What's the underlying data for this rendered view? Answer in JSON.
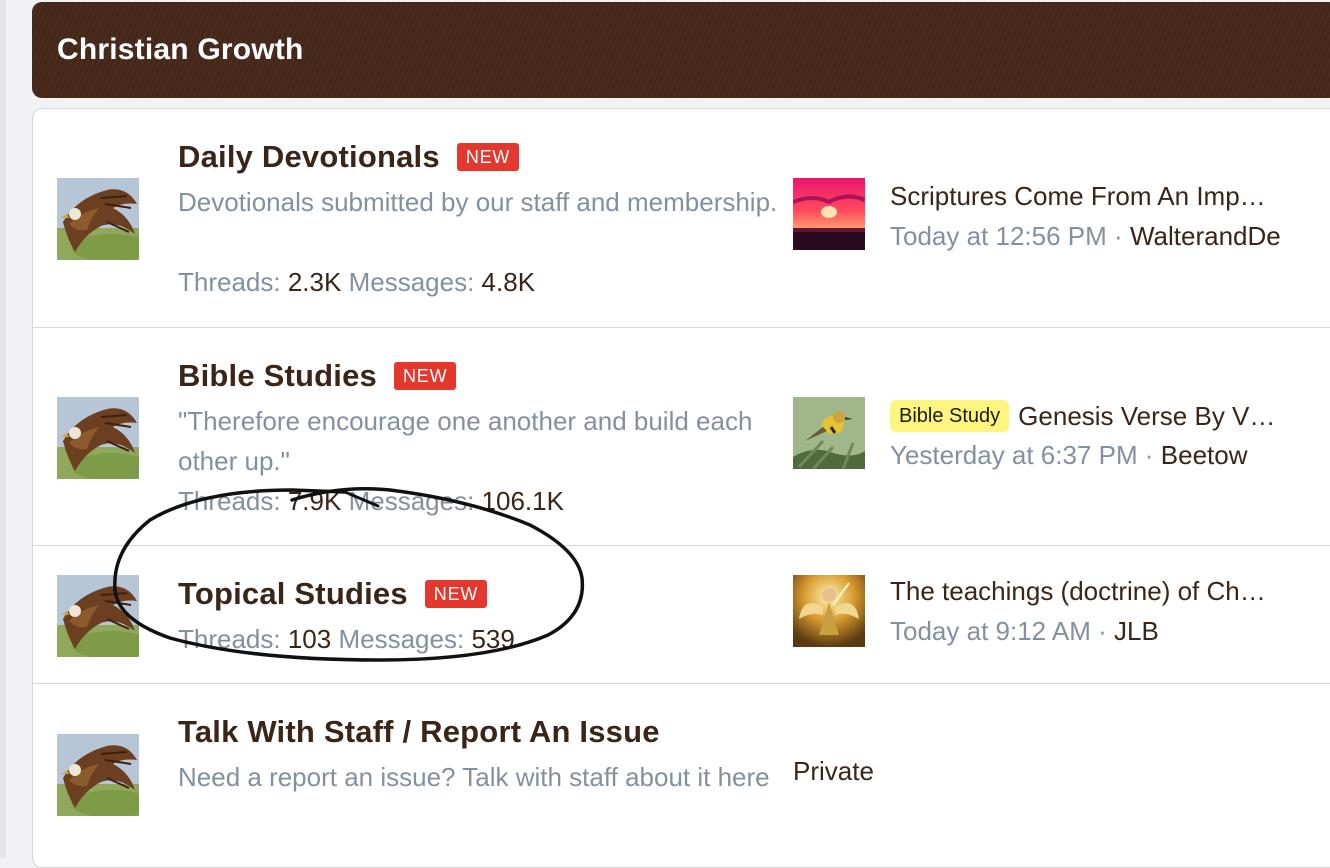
{
  "category": {
    "title": "Christian Growth",
    "color": "#46281a"
  },
  "nodes": [
    {
      "title": "Daily Devotionals",
      "badge": "NEW",
      "description": "Devotionals submitted by our staff and membership.",
      "threads_label": "Threads:",
      "threads": "2.3K",
      "messages_label": "Messages:",
      "messages": "4.8K",
      "icon": "eagle-icon",
      "last_post": {
        "thumb": "sunset-avatar",
        "title": "Scriptures Come From An Imp…",
        "time": "Today at 12:56 PM",
        "sep": "·",
        "user": "WalterandDe"
      }
    },
    {
      "title": "Bible Studies",
      "badge": "NEW",
      "description": "\"Therefore encourage one another and build each other up.\"",
      "threads_label": "Threads:",
      "threads": "7.9K",
      "messages_label": "Messages:",
      "messages": "106.1K",
      "icon": "eagle-icon",
      "last_post": {
        "thumb": "bird-avatar",
        "prefix": "Bible Study",
        "title": "Genesis Verse By V…",
        "time": "Yesterday at 6:37 PM",
        "sep": "·",
        "user": "Beetow"
      }
    },
    {
      "title": "Topical Studies",
      "badge": "NEW",
      "threads_label": "Threads:",
      "threads": "103",
      "messages_label": "Messages:",
      "messages": "539",
      "icon": "eagle-icon",
      "last_post": {
        "thumb": "angel-avatar",
        "title": "The teachings (doctrine) of Ch…",
        "time": "Today at 9:12 AM",
        "sep": "·",
        "user": "JLB"
      }
    },
    {
      "title": "Talk With Staff / Report An Issue",
      "description": "Need a report an issue? Talk with staff about it here",
      "icon": "eagle-icon",
      "private_label": "Private"
    }
  ],
  "colors": {
    "badge": "#e4382e",
    "prefix": "#fdf57e",
    "title": "#3a2518",
    "muted": "#8390a0"
  }
}
